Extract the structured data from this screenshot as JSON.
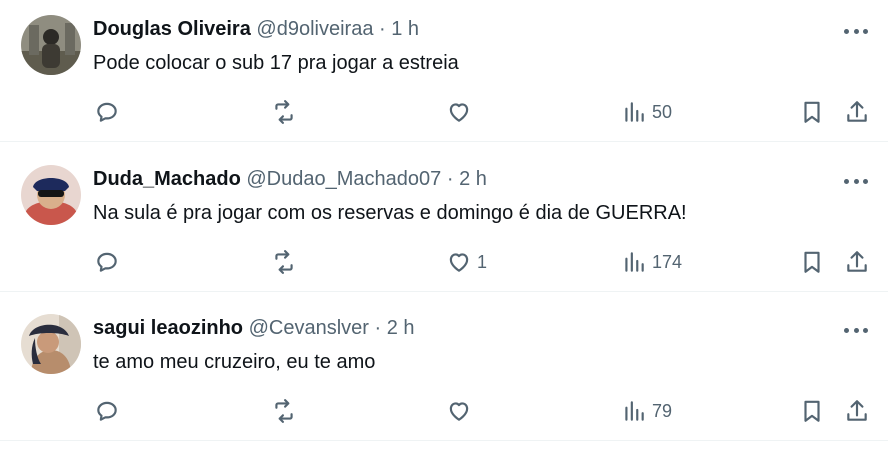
{
  "tweets": [
    {
      "name": "Douglas Oliveira",
      "handle": "@d9oliveiraa",
      "separator": "·",
      "time": "1 h",
      "text": "Pode colocar o sub 17 pra jogar a estreia",
      "likes": "",
      "views": "50",
      "avatar_colors": [
        "#3d3a33",
        "#7b7a6e"
      ]
    },
    {
      "name": "Duda_Machado",
      "handle": "@Dudao_Machado07",
      "separator": "·",
      "time": "2 h",
      "text": "Na sula é pra jogar com os reservas e domingo é dia de GUERRA!",
      "likes": "1",
      "views": "174",
      "avatar_colors": [
        "#c9574c",
        "#2b2a3a"
      ]
    },
    {
      "name": "sagui leaozinho",
      "handle": "@Cevanslver",
      "separator": "·",
      "time": "2 h",
      "text": "te amo meu cruzeiro, eu te amo",
      "likes": "",
      "views": "79",
      "avatar_colors": [
        "#d9cfc2",
        "#2a2d3d"
      ]
    }
  ],
  "icons": {
    "more": "more-horizontal-icon",
    "reply": "reply-bubble-icon",
    "repost": "repost-icon",
    "like": "heart-icon",
    "views": "views-bar-chart-icon",
    "bookmark": "bookmark-icon",
    "share": "share-icon"
  },
  "colors": {
    "text": "#0f1419",
    "secondary": "#536471",
    "divider": "#eff3f4"
  }
}
